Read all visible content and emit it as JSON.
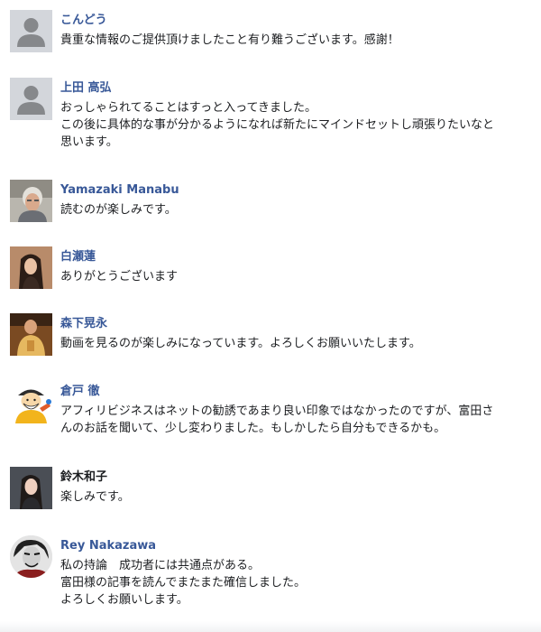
{
  "comments": [
    {
      "author": "こんどう",
      "lines": [
        "貴重な情報のご提供頂けましたこと有り難うございます。感謝！"
      ]
    },
    {
      "author": "上田 高弘",
      "lines": [
        "おっしゃられてることはすっと入ってきました。",
        "この後に具体的な事が分かるようになれば新たにマインドセットし頑張りたいなと",
        "思います。"
      ]
    },
    {
      "author": "Yamazaki Manabu",
      "lines": [
        "読むのが楽しみです。"
      ]
    },
    {
      "author": "白瀬蓮",
      "lines": [
        "ありがとうございます"
      ]
    },
    {
      "author": "森下晃永",
      "lines": [
        "動画を見るのが楽しみになっています。よろしくお願いいたします。"
      ]
    },
    {
      "author": "倉戸 徹",
      "lines": [
        "アフィリビジネスはネットの勧誘であまり良い印象ではなかったのですが、富田さ",
        "んのお話を聞いて、少し変わりました。もしかしたら自分もできるかも。"
      ]
    },
    {
      "author": "鈴木和子",
      "lines": [
        "楽しみです。"
      ]
    },
    {
      "author": "Rey Nakazawa",
      "lines": [
        "私の持論　成功者には共通点がある。",
        "富田様の記事を読んでまたまた確信しました。",
        "よろしくお願いします。"
      ]
    }
  ],
  "colors": {
    "author_link": "#385898",
    "text": "#1c1e21",
    "default_avatar_bg": "#d3d6db",
    "default_avatar_fg": "#86888b"
  }
}
